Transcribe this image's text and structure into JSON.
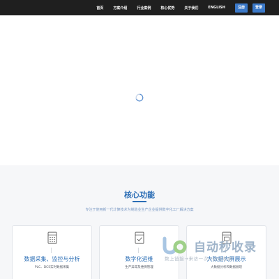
{
  "nav": {
    "items": [
      {
        "label": "首页",
        "name": "nav-home"
      },
      {
        "label": "方案介绍",
        "name": "nav-solutions"
      },
      {
        "label": "行业案例",
        "name": "nav-cases"
      },
      {
        "label": "核心优势",
        "name": "nav-advantages"
      },
      {
        "label": "关于我们",
        "name": "nav-about"
      },
      {
        "label": "ENGLISH",
        "name": "nav-english"
      }
    ],
    "register_label": "注册",
    "login_label": "登录"
  },
  "hero": {
    "loading_icon": "spinner-icon"
  },
  "features": {
    "title": "核心功能",
    "subtitle": "专注于使用新一代计算技术为制造业生产企业提供数字化工厂解决方案",
    "cards": [
      {
        "title": "数据采集、监控与分析",
        "desc": "PLC、DCS实时数据采集",
        "icon": "server-rack-icon"
      },
      {
        "title": "数字化运维",
        "desc": "生产异常及维保管理",
        "icon": "maintenance-doc-icon"
      },
      {
        "title": "大数据大屏展示",
        "desc": "大数据分析和数据展现",
        "icon": "bigscreen-display-icon"
      }
    ]
  },
  "watermark": {
    "brand": "自动秒收录",
    "tagline": "数上链接→来访一次→自动收录"
  },
  "colors": {
    "topbar_bg": "#1f1f1f",
    "accent_blue": "#2a6db5",
    "button_blue": "#3b79c9"
  }
}
